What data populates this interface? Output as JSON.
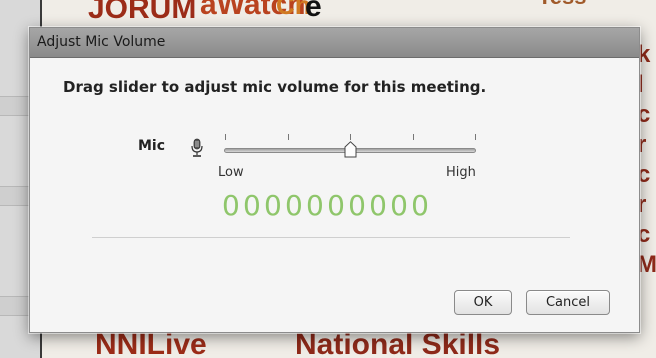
{
  "background": {
    "words": {
      "jorum": "JORUM",
      "watch": "aWatch",
      "ch": "Ch",
      "blk": "e",
      "tess": "Tess",
      "nnilive": "NNILive",
      "national": "National Skills",
      "rightcol": "k\nl\nc\nr\nc\nr\nc\nM"
    }
  },
  "dialog": {
    "title": "Adjust Mic Volume",
    "instruction": "Drag slider to adjust mic volume for this meeting.",
    "mic_label": "Mic",
    "slider": {
      "low_label": "Low",
      "high_label": "High",
      "value": 0.5,
      "ticks": 5
    },
    "level_meter": "0000000000",
    "buttons": {
      "ok": "OK",
      "cancel": "Cancel"
    }
  },
  "colors": {
    "level_meter": "#8fc66b",
    "titlebar": "#999999",
    "dialog_bg": "#f5f5f5"
  },
  "icons": {
    "mic": "microphone-icon"
  }
}
